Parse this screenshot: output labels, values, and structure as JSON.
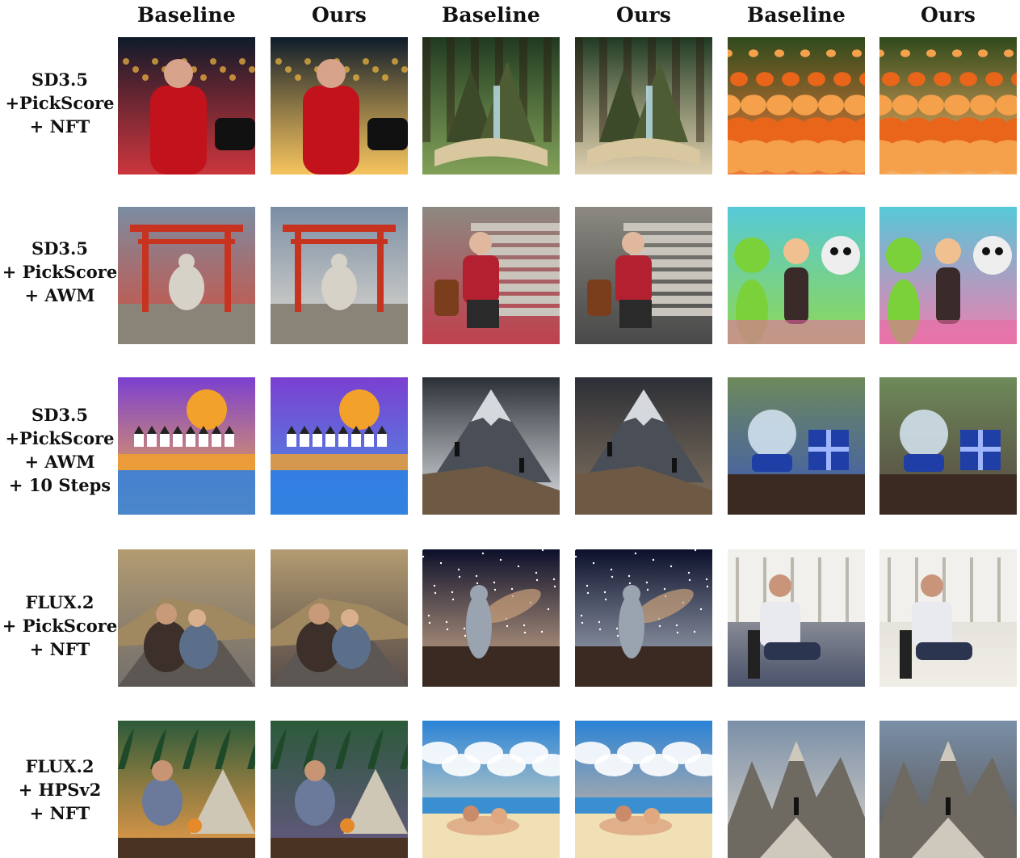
{
  "columns": [
    "Baseline",
    "Ours",
    "Baseline",
    "Ours",
    "Baseline",
    "Ours"
  ],
  "rows": [
    {
      "label_lines": [
        "SD3.5",
        "+PickScore",
        "+ NFT"
      ],
      "tiles": [
        {
          "theme": "city-night",
          "depiction": "man with phone at night street"
        },
        {
          "theme": "city-night",
          "depiction": "man with phone at night street"
        },
        {
          "theme": "forest-book",
          "depiction": "pop-up book with cliffs and waterfall"
        },
        {
          "theme": "forest-book",
          "depiction": "pop-up book with cliffs and waterfall"
        },
        {
          "theme": "pumpkins",
          "depiction": "field of pumpkins"
        },
        {
          "theme": "pumpkins",
          "depiction": "field of pumpkins"
        }
      ]
    },
    {
      "label_lines": [
        "SD3.5",
        "+ PickScore",
        "+ AWM"
      ],
      "tiles": [
        {
          "theme": "torii",
          "depiction": "torii gate with Buddha statue"
        },
        {
          "theme": "torii",
          "depiction": "torii gate with Buddha statue"
        },
        {
          "theme": "stairs-woman",
          "depiction": "woman with backpack sitting on stairs"
        },
        {
          "theme": "stairs-woman",
          "depiction": "woman with backpack sitting on stairs"
        },
        {
          "theme": "graffiti",
          "depiction": "alien and women in front of graffiti wall"
        },
        {
          "theme": "graffiti",
          "depiction": "alien and women in front of graffiti wall"
        }
      ]
    },
    {
      "label_lines": [
        "SD3.5",
        "+PickScore",
        "+ AWM",
        "+ 10 Steps"
      ],
      "tiles": [
        {
          "theme": "painting-village",
          "depiction": "colorful painting of village by lake"
        },
        {
          "theme": "painting-village",
          "depiction": "colorful painting of village by lake"
        },
        {
          "theme": "mountain",
          "depiction": "hikers on rocky mountain"
        },
        {
          "theme": "mountain",
          "depiction": "hikers on rocky mountain"
        },
        {
          "theme": "snowglobe",
          "depiction": "snow globe and blue gift box on table"
        },
        {
          "theme": "snowglobe",
          "depiction": "snow globe and blue gift box on table"
        }
      ]
    },
    {
      "label_lines": [
        "FLUX.2",
        "+ PickScore",
        "+ NFT"
      ],
      "tiles": [
        {
          "theme": "road-couple",
          "depiction": "couple sitting on road with skateboard"
        },
        {
          "theme": "road-couple",
          "depiction": "couple sitting on road with skateboard"
        },
        {
          "theme": "galaxy",
          "depiction": "chrome figure under galaxy sky"
        },
        {
          "theme": "galaxy",
          "depiction": "chrome figure under galaxy sky"
        },
        {
          "theme": "cafe-man",
          "depiction": "man sitting in chair with drink"
        },
        {
          "theme": "cafe-man",
          "depiction": "man sitting in chair with drink"
        }
      ]
    },
    {
      "label_lines": [
        "FLUX.2",
        "+ HPSv2",
        "+ NFT"
      ],
      "tiles": [
        {
          "theme": "camping",
          "depiction": "man camping with tent and lanterns"
        },
        {
          "theme": "camping",
          "depiction": "man camping with tent and lanterns"
        },
        {
          "theme": "beach",
          "depiction": "couple lying on beach under clouds"
        },
        {
          "theme": "beach",
          "depiction": "couple lying on beach under clouds"
        },
        {
          "theme": "peaks",
          "depiction": "man standing before dramatic peaks"
        },
        {
          "theme": "peaks",
          "depiction": "man standing before dramatic peaks"
        }
      ]
    }
  ],
  "theme_colors": {
    "city-night": [
      "#0d1b2a",
      "#c2121b",
      "#f4b942"
    ],
    "forest-book": [
      "#1f3a22",
      "#6b8f3a",
      "#d9c7a0"
    ],
    "pumpkins": [
      "#2f4a1c",
      "#e8651a",
      "#f5a04a"
    ],
    "torii": [
      "#7a8da3",
      "#c8331f",
      "#d7d2c8"
    ],
    "stairs-woman": [
      "#8c8a82",
      "#b32030",
      "#2a2a2a"
    ],
    "graffiti": [
      "#55c9d9",
      "#7bd13a",
      "#e86aa3"
    ],
    "painting-village": [
      "#7b3fd1",
      "#f2a12a",
      "#2d7fe0"
    ],
    "mountain": [
      "#2b2f36",
      "#d5d8dc",
      "#6e5a44"
    ],
    "snowglobe": [
      "#6e8a5a",
      "#1f3fa6",
      "#3a2a22"
    ],
    "road-couple": [
      "#b39c72",
      "#5c5753",
      "#3d2f2a"
    ],
    "galaxy": [
      "#0b0f2a",
      "#c9a07a",
      "#9aa3b0"
    ],
    "cafe-man": [
      "#d8d6d0",
      "#2c3550",
      "#eeeae3"
    ],
    "camping": [
      "#2c5a3a",
      "#e58a2a",
      "#4a3b6b"
    ],
    "beach": [
      "#2a83d6",
      "#f1e0b5",
      "#e0b08a"
    ],
    "peaks": [
      "#7a8fa8",
      "#cfc9bd",
      "#3d3a36"
    ]
  }
}
